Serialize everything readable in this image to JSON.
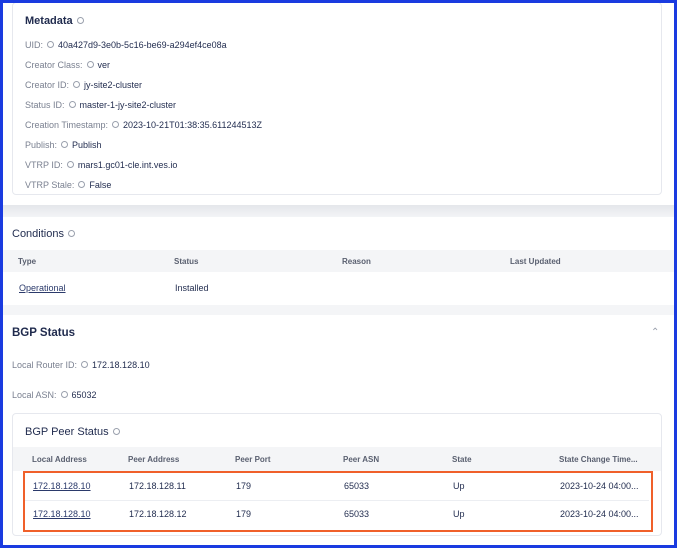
{
  "metadata": {
    "title": "Metadata",
    "fields": [
      {
        "label": "UID:",
        "value": "40a427d9-3e0b-5c16-be69-a294ef4ce08a"
      },
      {
        "label": "Creator Class:",
        "value": "ver"
      },
      {
        "label": "Creator ID:",
        "value": "jy-site2-cluster"
      },
      {
        "label": "Status ID:",
        "value": "master-1-jy-site2-cluster"
      },
      {
        "label": "Creation Timestamp:",
        "value": "2023-10-21T01:38:35.611244513Z"
      },
      {
        "label": "Publish:",
        "value": "Publish"
      },
      {
        "label": "VTRP ID:",
        "value": "mars1.gc01-cle.int.ves.io"
      },
      {
        "label": "VTRP Stale:",
        "value": "False"
      }
    ]
  },
  "conditions": {
    "title": "Conditions",
    "columns": [
      "Type",
      "Status",
      "Reason",
      "Last Updated"
    ],
    "rows": [
      {
        "type": "Operational",
        "status": "Installed",
        "reason": "",
        "last_updated": ""
      }
    ]
  },
  "bgp": {
    "title": "BGP Status",
    "local_router_id_label": "Local Router ID:",
    "local_router_id": "172.18.128.10",
    "local_asn_label": "Local ASN:",
    "local_asn": "65032",
    "peer": {
      "title": "BGP Peer Status",
      "columns": [
        "Local Address",
        "Peer Address",
        "Peer Port",
        "Peer ASN",
        "State",
        "State Change Time..."
      ],
      "rows": [
        [
          "172.18.128.10",
          "172.18.128.11",
          "179",
          "65033",
          "Up",
          "2023-10-24 04:00..."
        ],
        [
          "172.18.128.10",
          "172.18.128.12",
          "179",
          "65033",
          "Up",
          "2023-10-24 04:00..."
        ]
      ]
    }
  }
}
